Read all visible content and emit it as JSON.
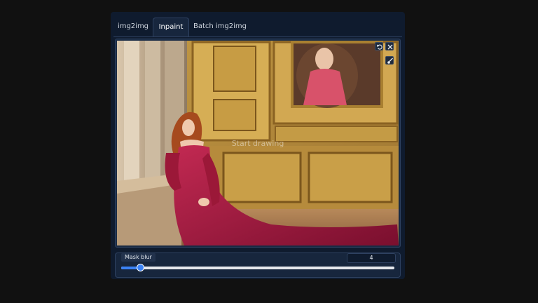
{
  "tabs": [
    {
      "label": "img2img",
      "active": false
    },
    {
      "label": "Inpaint",
      "active": true
    },
    {
      "label": "Batch img2img",
      "active": false
    }
  ],
  "canvas": {
    "hint": "Start drawing",
    "buttons": [
      "undo-icon",
      "close-icon",
      "brush-icon"
    ]
  },
  "mask_blur": {
    "label": "Mask blur",
    "value": "4",
    "fraction": 0.07
  },
  "colors": {
    "accent": "#3b82f6",
    "panel": "#0f1b2e",
    "background": "#111111"
  }
}
